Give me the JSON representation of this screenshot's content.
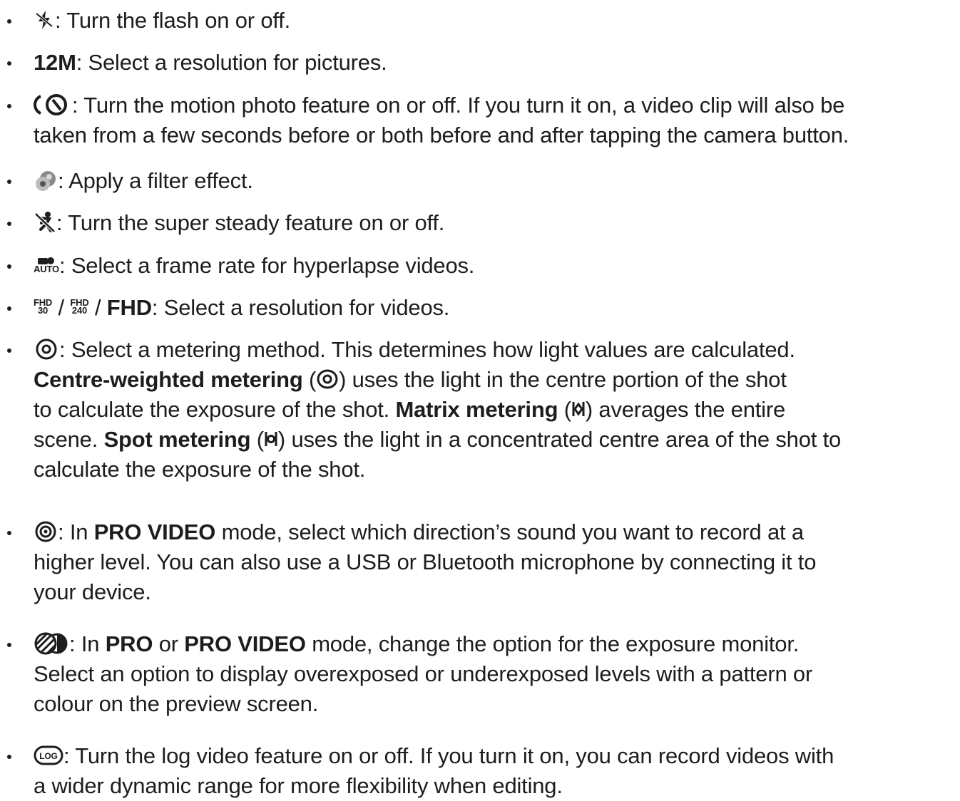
{
  "items": [
    {
      "icon": "flash-off-icon",
      "text": ": Turn the flash on or off."
    },
    {
      "bold": "12M",
      "text": ": Select a resolution for pictures."
    },
    {
      "icon": "motion-photo-icon",
      "text": ": Turn the motion photo feature on or off. If you turn it on, a video clip will also be",
      "line2": "taken from a few seconds before or both before and after tapping the camera button."
    },
    {
      "icon": "filter-icon",
      "text": ": Apply a filter effect."
    },
    {
      "icon": "super-steady-icon",
      "text": ": Turn the super steady feature on or off."
    },
    {
      "icon": "frame-rate-icon",
      "icon_label": "AUTO",
      "text": ": Select a frame rate for hyperlapse videos."
    },
    {
      "icon": "video-resolution-icons",
      "fhd30_top": "FHD",
      "fhd30_bottom": "30",
      "fhd240_top": "FHD",
      "fhd240_bottom": "240",
      "sep": "/",
      "bold": "FHD",
      "text": ": Select a resolution for videos."
    },
    {
      "icon": "metering-icon",
      "text": ": Select a metering method. This determines how light values are calculated.",
      "cw_bold": "Centre-weighted metering",
      "cw_text": ") uses the light in the centre portion of the shot",
      "line3a": "to calculate the exposure of the shot.",
      "matrix_bold": "Matrix metering",
      "matrix_text": ") averages the entire",
      "line4a": "scene.",
      "spot_bold": "Spot metering",
      "spot_text": ") uses the light in a concentrated centre area of the shot to",
      "line5": "calculate the exposure of the shot.",
      "open_paren": "("
    },
    {
      "icon": "audio-direction-icon",
      "text_a": ": In",
      "bold": "PRO VIDEO",
      "text_b": "mode, select which direction’s sound you want to record at a",
      "line2": "higher level. You can also use a USB or Bluetooth microphone by connecting it to",
      "line3": "your device."
    },
    {
      "icon": "exposure-monitor-icon",
      "text_a": ": In",
      "bold1": "PRO",
      "text_b": "or",
      "bold2": "PRO VIDEO",
      "text_c": "mode, change the option for the exposure monitor.",
      "line2": "Select an option to display overexposed or underexposed levels with a pattern or",
      "line3": "colour on the preview screen."
    },
    {
      "icon": "log-video-icon",
      "icon_label": "LOG",
      "text": ": Turn the log video feature on or off. If you turn it on, you can record videos with",
      "line2": "a wider dynamic range for more flexibility when editing."
    }
  ]
}
